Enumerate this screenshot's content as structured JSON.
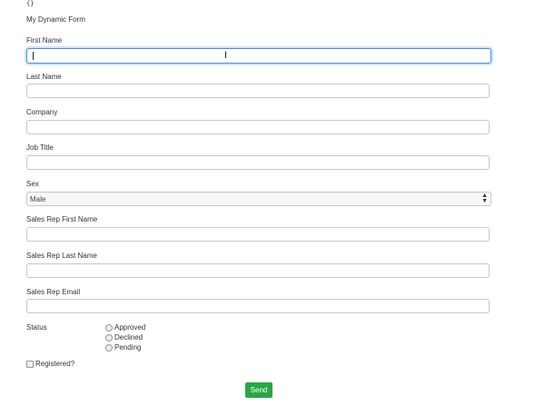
{
  "debug_text": "{}",
  "form": {
    "title": "My Dynamic Form",
    "fields": {
      "first_name": {
        "label": "First Name",
        "value": "",
        "placeholder": ""
      },
      "last_name": {
        "label": "Last Name",
        "value": "",
        "placeholder": ""
      },
      "company": {
        "label": "Company",
        "value": "",
        "placeholder": ""
      },
      "job_title": {
        "label": "Job Title",
        "value": "",
        "placeholder": ""
      },
      "sex": {
        "label": "Sex",
        "value": "Male"
      },
      "sales_rep_first_name": {
        "label": "Sales Rep First Name",
        "value": "",
        "placeholder": ""
      },
      "sales_rep_last_name": {
        "label": "Sales Rep Last Name",
        "value": "",
        "placeholder": ""
      },
      "sales_rep_email": {
        "label": "Sales Rep Email",
        "value": "",
        "placeholder": ""
      }
    },
    "status": {
      "label": "Status",
      "options": [
        "Approved",
        "Declined",
        "Pending"
      ]
    },
    "registered": {
      "label": "Registered?",
      "checked": false
    },
    "send_label": "Send"
  },
  "colors": {
    "focus_border": "#4a90d9",
    "send_button": "#28a745"
  },
  "icons": [
    "text-cursor-icon",
    "select-arrows-icon"
  ]
}
